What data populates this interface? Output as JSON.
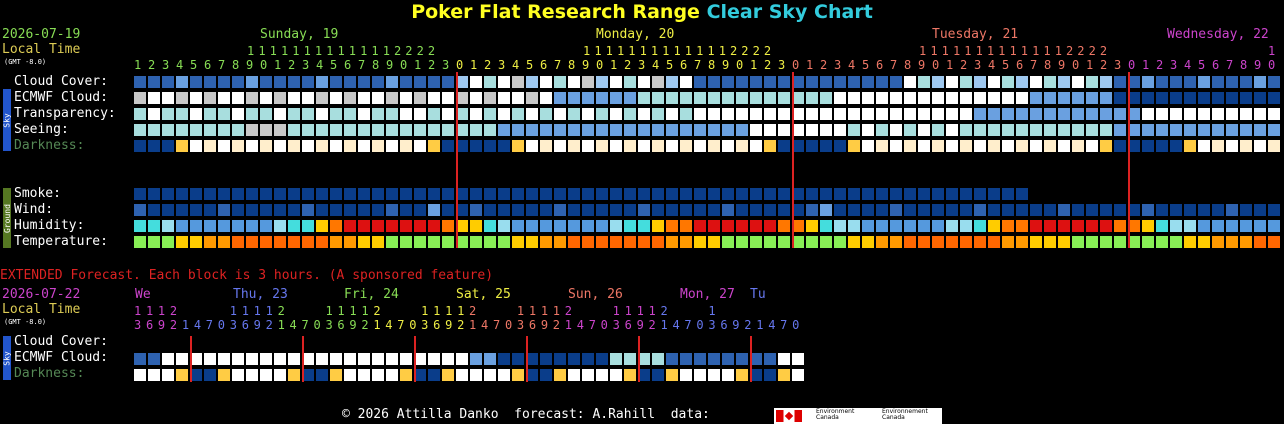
{
  "title": {
    "site": "Poker Flat Research Range",
    "product": "Clear Sky Chart",
    "colors": {
      "site": "#ffff22",
      "product": "#33ccdd"
    }
  },
  "header": {
    "date": "2026-07-19",
    "local_time": "Local Time",
    "gmt": "(GMT -8.0)",
    "days": [
      {
        "label": "Sunday, 19",
        "color": "#88dd55"
      },
      {
        "label": "Monday, 20",
        "color": "#eeee44"
      },
      {
        "label": "Tuesday, 21",
        "color": "#ee7766"
      },
      {
        "label": "Wednesday, 22",
        "color": "#cc44cc"
      }
    ],
    "hour_tens_rows": [
      "          11111111111112222 ",
      "          11111111111112222 ",
      "          11111111111112222 "
    ],
    "hours": "1234567890123456789012301234567890123456789012301234567890123456789012301234567890"
  },
  "sky_rows": [
    {
      "label": "Cloud Cover:",
      "color": "#ffffff"
    },
    {
      "label": "ECMWF Cloud:",
      "color": "#ffffff"
    },
    {
      "label": "Transparency:",
      "color": "#ffffff"
    },
    {
      "label": "Seeing:",
      "color": "#ffffff"
    },
    {
      "label": "Darkness:",
      "color": "#558855"
    }
  ],
  "ground_rows": [
    {
      "label": "Smoke:"
    },
    {
      "label": "Wind:"
    },
    {
      "label": "Humidity:"
    },
    {
      "label": "Temperature:"
    }
  ],
  "side_labels": {
    "sky": "Sky",
    "ground": "Ground"
  },
  "extended": {
    "note": "EXTENDED Forecast. Each block is 3 hours. (A sponsored feature)",
    "date": "2026-07-22",
    "local_time": "Local Time",
    "gmt": "(GMT -8.0)",
    "days": [
      {
        "label": "We",
        "color": "#cc44cc"
      },
      {
        "label": "Thu, 23",
        "color": "#6677ee"
      },
      {
        "label": "Fri, 24",
        "color": "#88dd55"
      },
      {
        "label": "Sat, 25",
        "color": "#eeee44"
      },
      {
        "label": "Sun, 26",
        "color": "#ee7766"
      },
      {
        "label": "Mon, 27",
        "color": "#cc44cc"
      },
      {
        "label": "Tu",
        "color": "#6677ee"
      }
    ],
    "tens_row": "1112    11112   11112   11112   11112   11112   1",
    "hours_row": "36921470369214703692147036921470369214703692147036921470",
    "rows": [
      {
        "label": "Cloud Cover:"
      },
      {
        "label": "ECMWF Cloud:"
      },
      {
        "label": "Darkness:"
      }
    ]
  },
  "footer": {
    "copyright": "© 2026 Attilla Danko  forecast: A.Rahill  data:",
    "logo_text_1": "Environment\nCanada",
    "logo_text_2": "Environnement\nCanada"
  },
  "palette": {
    "dark_blue": "#0a3d8a",
    "mid_blue": "#2e62b0",
    "light_blue": "#6aa0e0",
    "pale_blue": "#9ec8f0",
    "cyan_pale": "#a8dede",
    "gray": "#c8c8c8",
    "white": "#ffffff",
    "midnight_red": "#dd2222"
  }
}
